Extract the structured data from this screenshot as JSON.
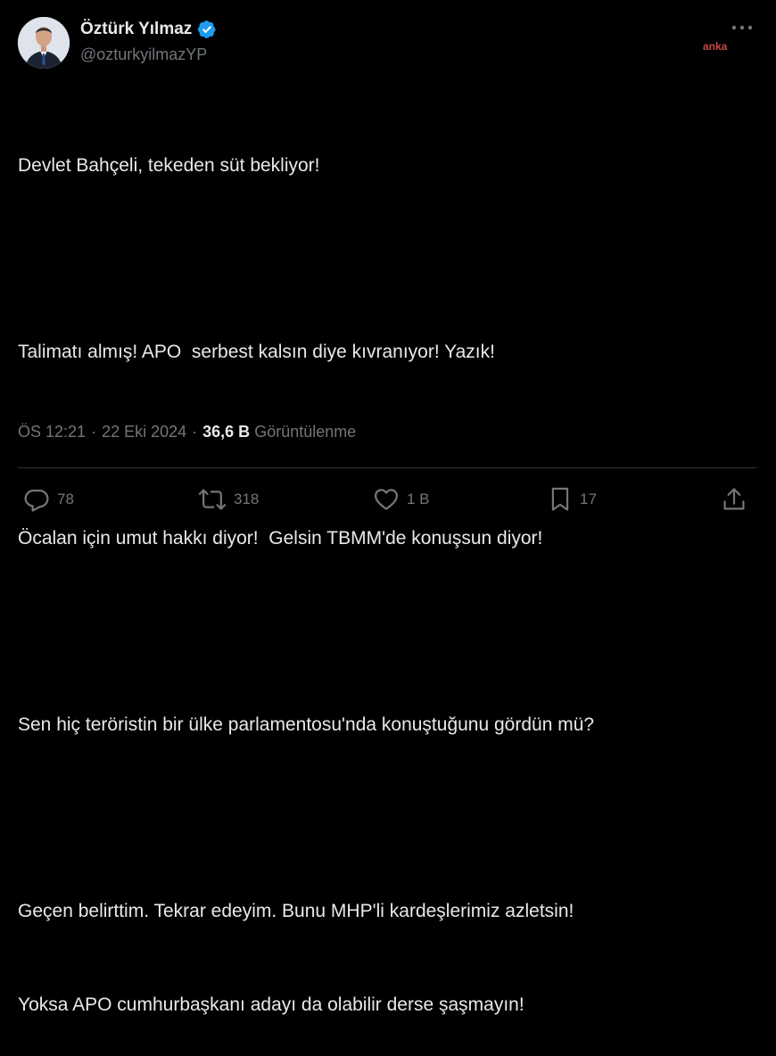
{
  "author": {
    "name": "Öztürk Yılmaz",
    "handle": "@ozturkyilmazYP",
    "verified": true,
    "avatar_icon": "profile-photo"
  },
  "watermark": "anka",
  "tweet": {
    "paragraphs": [
      [
        "Devlet Bahçeli, tekeden süt bekliyor!"
      ],
      [
        "Talimatı almış! APO  serbest kalsın diye kıvranıyor! Yazık!"
      ],
      [
        "Öcalan için umut hakkı diyor!  Gelsin TBMM'de konuşsun diyor!"
      ],
      [
        "Sen hiç teröristin bir ülke parlamentosu'nda konuştuğunu gördün mü?"
      ],
      [
        "Geçen belirttim. Tekrar edeyim. Bunu MHP'li kardeşlerimiz azletsin!",
        "Yoksa APO cumhurbaşkanı adayı da olabilir derse şaşmayın!"
      ]
    ]
  },
  "meta": {
    "time": "ÖS 12:21",
    "separator": "·",
    "date": "22 Eki 2024",
    "views": "36,6 B",
    "views_label": "Görüntülenme"
  },
  "actions": {
    "reply": {
      "icon": "reply-icon",
      "count": "78"
    },
    "retweet": {
      "icon": "retweet-icon",
      "count": "318"
    },
    "like": {
      "icon": "heart-icon",
      "count": "1 B"
    },
    "bookmark": {
      "icon": "bookmark-icon",
      "count": "17"
    },
    "share": {
      "icon": "share-icon"
    }
  },
  "colors": {
    "background": "#000000",
    "text": "#e7e9ea",
    "secondary": "#71767b",
    "divider": "#2f3336",
    "verified": "#1d9bf0",
    "watermark": "#c44a43"
  }
}
